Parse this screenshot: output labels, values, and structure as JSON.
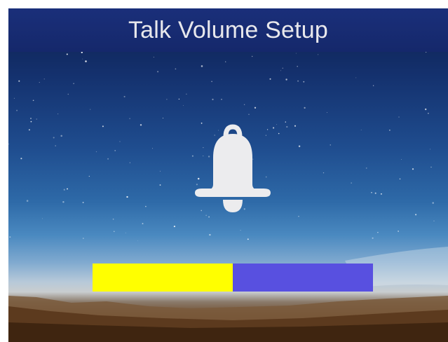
{
  "screen": {
    "title": "Talk Volume Setup"
  },
  "icon": {
    "name": "bell-icon"
  },
  "volume": {
    "level_fraction": 0.5,
    "fill_color": "#ffff00",
    "track_color": "#5850e0"
  },
  "colors": {
    "title_bar": "#1a2f7a",
    "title_text": "#e8e8ec",
    "bell": "#ececee"
  }
}
